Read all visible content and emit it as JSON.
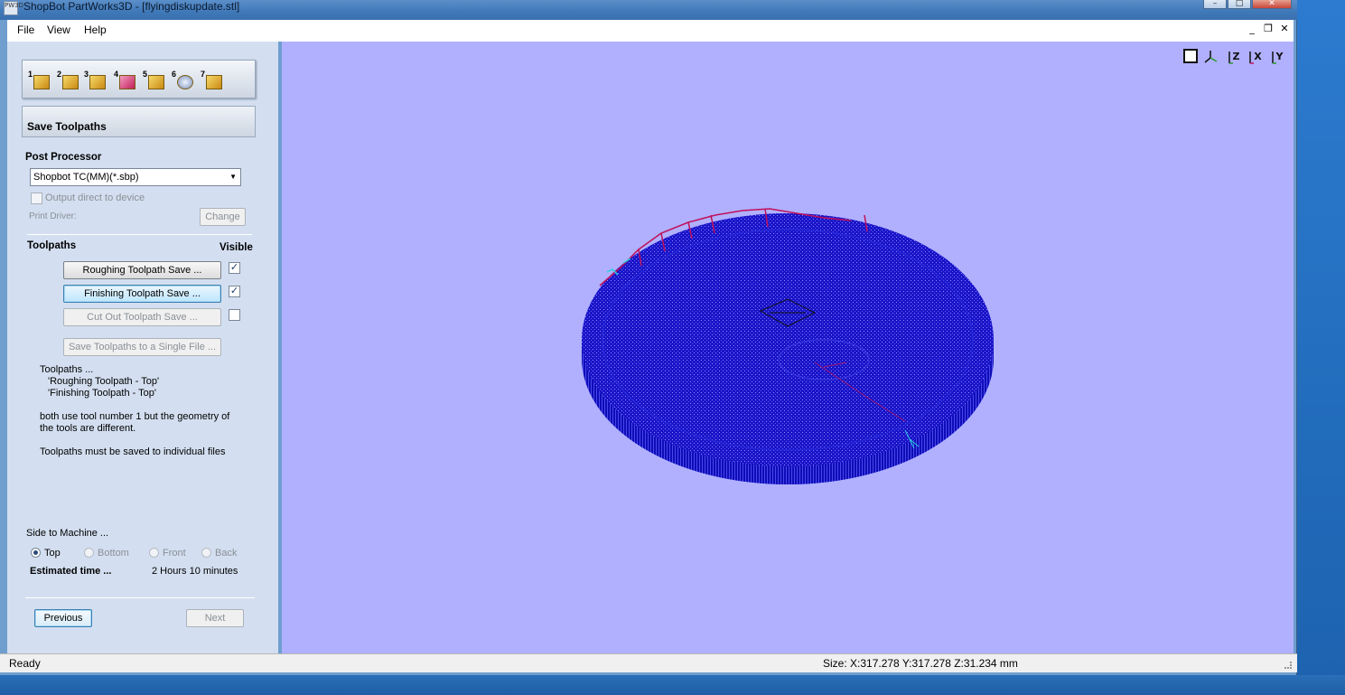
{
  "window": {
    "icon_label": "PW3D",
    "title": "ShopBot PartWorks3D - [flyingdiskupdate.stl]",
    "minimize": "–",
    "maximize": "□",
    "close": "✕"
  },
  "menu": {
    "items": [
      "File",
      "View",
      "Help"
    ],
    "mdi_minimize": "_",
    "mdi_restore": "❐",
    "mdi_close": "✕"
  },
  "steps": {
    "labels": [
      "1",
      "2",
      "3",
      "4",
      "5",
      "6",
      "7"
    ],
    "icons": [
      "material-setup-icon",
      "import-model-icon",
      "roughing-toolpath-icon",
      "finishing-toolpath-icon",
      "cutout-toolpath-icon",
      "preview-toolpath-icon",
      "save-toolpath-icon"
    ]
  },
  "panel": {
    "header": "Save Toolpaths",
    "post_processor_label": "Post Processor",
    "post_processor_value": "Shopbot TC(MM)(*.sbp)",
    "output_direct_label": "Output direct to device",
    "print_driver_label": "Print Driver:",
    "change_button": "Change",
    "toolpaths_label": "Toolpaths",
    "visible_label": "Visible",
    "roughing_button": "Roughing Toolpath Save ...",
    "finishing_button": "Finishing Toolpath Save ...",
    "cutout_button": "Cut Out Toolpath Save ...",
    "single_file_button": "Save Toolpaths to a Single File ...",
    "info_lines": [
      "Toolpaths ...",
      "'Roughing Toolpath  - Top'",
      "'Finishing Toolpath  - Top'",
      "both use  tool number  1 but the geometry of",
      "the tools are different.",
      "Toolpaths must be saved to individual files"
    ],
    "side_label": "Side to Machine ...",
    "sides": [
      "Top",
      "Bottom",
      "Front",
      "Back"
    ],
    "estimated_label": "Estimated time ...",
    "estimated_value": "2 Hours 10 minutes",
    "previous_button": "Previous",
    "next_button": "Next"
  },
  "visibility": {
    "roughing": true,
    "finishing": true,
    "cutout": false
  },
  "view_controls": {
    "labels": [
      "",
      "",
      "Z",
      "X",
      "Y"
    ],
    "icons": [
      "zoom-extents-icon",
      "iso-view-icon",
      "view-z-icon",
      "view-x-icon",
      "view-y-icon"
    ]
  },
  "status": {
    "left": "Ready",
    "size": "Size: X:317.278 Y:317.278 Z:31.234 mm"
  },
  "colors": {
    "viewport_bg": "#b0b0ff",
    "disk_blue": "#1010c8",
    "toolpath_red": "#c0105a"
  }
}
